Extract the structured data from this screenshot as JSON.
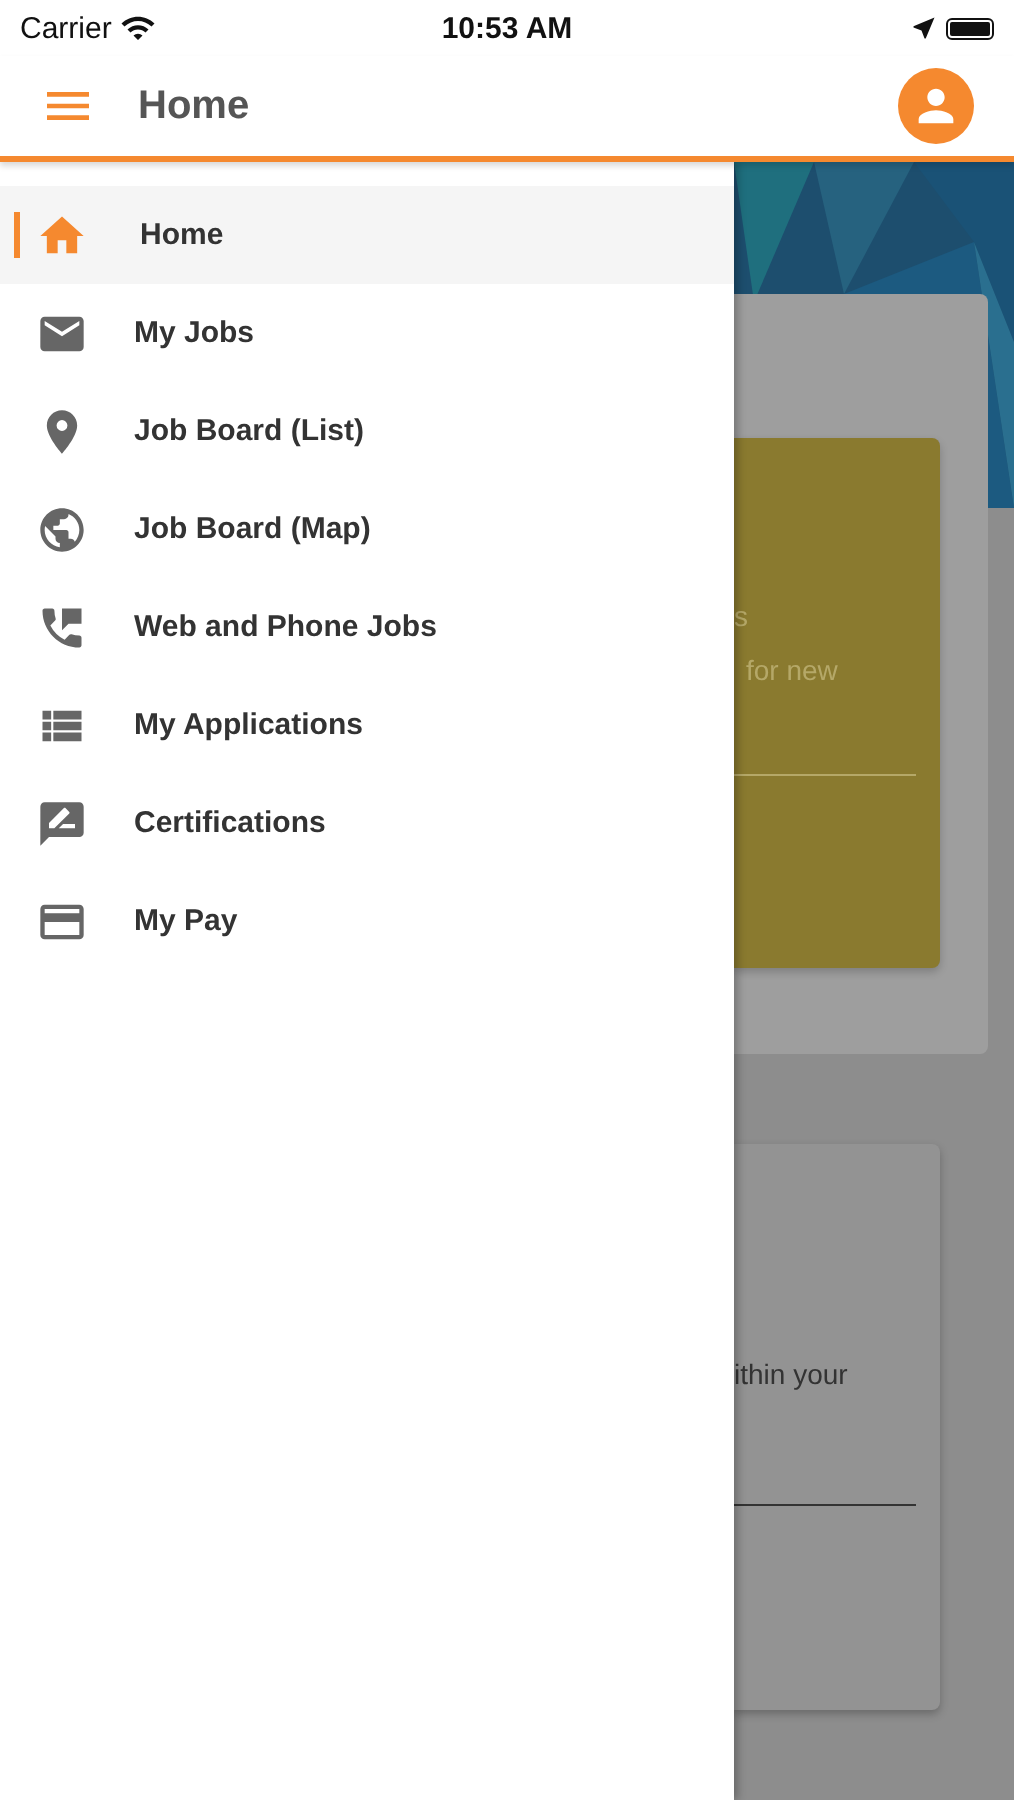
{
  "status_bar": {
    "carrier": "Carrier",
    "time": "10:53 AM"
  },
  "header": {
    "title": "Home"
  },
  "drawer": {
    "items": [
      {
        "label": "Home",
        "selected": true
      },
      {
        "label": "My Jobs",
        "selected": false
      },
      {
        "label": "Job Board (List)",
        "selected": false
      },
      {
        "label": "Job Board (Map)",
        "selected": false
      },
      {
        "label": "Web and Phone Jobs",
        "selected": false
      },
      {
        "label": "My Applications",
        "selected": false
      },
      {
        "label": "Certifications",
        "selected": false
      },
      {
        "label": "My Pay",
        "selected": false
      }
    ]
  },
  "background": {
    "promo_card": {
      "lines": [
        "s",
        "for new"
      ]
    },
    "info_card": {
      "lines": [
        "ithin your"
      ]
    }
  }
}
